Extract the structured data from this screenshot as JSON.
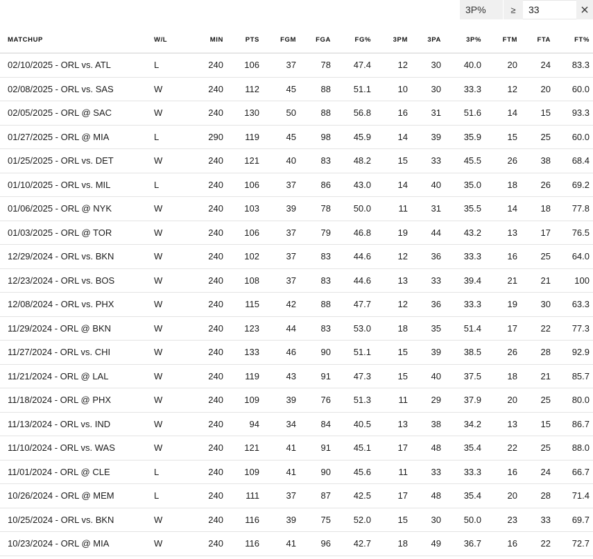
{
  "filter": {
    "stat": "3P%",
    "operator": "≥",
    "value": "33",
    "icons": {
      "clear": "close-icon"
    }
  },
  "columns": [
    "MATCHUP",
    "W/L",
    "MIN",
    "PTS",
    "FGM",
    "FGA",
    "FG%",
    "3PM",
    "3PA",
    "3P%",
    "FTM",
    "FTA",
    "FT%"
  ],
  "colors": {
    "link": "#1d68c5",
    "text": "#1a1a1a",
    "filter_bg": "#f0f0f0"
  },
  "rows": [
    [
      "02/10/2025 - ORL vs. ATL",
      "L",
      "240",
      "106",
      "37",
      "78",
      "47.4",
      "12",
      "30",
      "40.0",
      "20",
      "24",
      "83.3"
    ],
    [
      "02/08/2025 - ORL vs. SAS",
      "W",
      "240",
      "112",
      "45",
      "88",
      "51.1",
      "10",
      "30",
      "33.3",
      "12",
      "20",
      "60.0"
    ],
    [
      "02/05/2025 - ORL @ SAC",
      "W",
      "240",
      "130",
      "50",
      "88",
      "56.8",
      "16",
      "31",
      "51.6",
      "14",
      "15",
      "93.3"
    ],
    [
      "01/27/2025 - ORL @ MIA",
      "L",
      "290",
      "119",
      "45",
      "98",
      "45.9",
      "14",
      "39",
      "35.9",
      "15",
      "25",
      "60.0"
    ],
    [
      "01/25/2025 - ORL vs. DET",
      "W",
      "240",
      "121",
      "40",
      "83",
      "48.2",
      "15",
      "33",
      "45.5",
      "26",
      "38",
      "68.4"
    ],
    [
      "01/10/2025 - ORL vs. MIL",
      "L",
      "240",
      "106",
      "37",
      "86",
      "43.0",
      "14",
      "40",
      "35.0",
      "18",
      "26",
      "69.2"
    ],
    [
      "01/06/2025 - ORL @ NYK",
      "W",
      "240",
      "103",
      "39",
      "78",
      "50.0",
      "11",
      "31",
      "35.5",
      "14",
      "18",
      "77.8"
    ],
    [
      "01/03/2025 - ORL @ TOR",
      "W",
      "240",
      "106",
      "37",
      "79",
      "46.8",
      "19",
      "44",
      "43.2",
      "13",
      "17",
      "76.5"
    ],
    [
      "12/29/2024 - ORL vs. BKN",
      "W",
      "240",
      "102",
      "37",
      "83",
      "44.6",
      "12",
      "36",
      "33.3",
      "16",
      "25",
      "64.0"
    ],
    [
      "12/23/2024 - ORL vs. BOS",
      "W",
      "240",
      "108",
      "37",
      "83",
      "44.6",
      "13",
      "33",
      "39.4",
      "21",
      "21",
      "100"
    ],
    [
      "12/08/2024 - ORL vs. PHX",
      "W",
      "240",
      "115",
      "42",
      "88",
      "47.7",
      "12",
      "36",
      "33.3",
      "19",
      "30",
      "63.3"
    ],
    [
      "11/29/2024 - ORL @ BKN",
      "W",
      "240",
      "123",
      "44",
      "83",
      "53.0",
      "18",
      "35",
      "51.4",
      "17",
      "22",
      "77.3"
    ],
    [
      "11/27/2024 - ORL vs. CHI",
      "W",
      "240",
      "133",
      "46",
      "90",
      "51.1",
      "15",
      "39",
      "38.5",
      "26",
      "28",
      "92.9"
    ],
    [
      "11/21/2024 - ORL @ LAL",
      "W",
      "240",
      "119",
      "43",
      "91",
      "47.3",
      "15",
      "40",
      "37.5",
      "18",
      "21",
      "85.7"
    ],
    [
      "11/18/2024 - ORL @ PHX",
      "W",
      "240",
      "109",
      "39",
      "76",
      "51.3",
      "11",
      "29",
      "37.9",
      "20",
      "25",
      "80.0"
    ],
    [
      "11/13/2024 - ORL vs. IND",
      "W",
      "240",
      "94",
      "34",
      "84",
      "40.5",
      "13",
      "38",
      "34.2",
      "13",
      "15",
      "86.7"
    ],
    [
      "11/10/2024 - ORL vs. WAS",
      "W",
      "240",
      "121",
      "41",
      "91",
      "45.1",
      "17",
      "48",
      "35.4",
      "22",
      "25",
      "88.0"
    ],
    [
      "11/01/2024 - ORL @ CLE",
      "L",
      "240",
      "109",
      "41",
      "90",
      "45.6",
      "11",
      "33",
      "33.3",
      "16",
      "24",
      "66.7"
    ],
    [
      "10/26/2024 - ORL @ MEM",
      "L",
      "240",
      "111",
      "37",
      "87",
      "42.5",
      "17",
      "48",
      "35.4",
      "20",
      "28",
      "71.4"
    ],
    [
      "10/25/2024 - ORL vs. BKN",
      "W",
      "240",
      "116",
      "39",
      "75",
      "52.0",
      "15",
      "30",
      "50.0",
      "23",
      "33",
      "69.7"
    ],
    [
      "10/23/2024 - ORL @ MIA",
      "W",
      "240",
      "116",
      "41",
      "96",
      "42.7",
      "18",
      "49",
      "36.7",
      "16",
      "22",
      "72.7"
    ]
  ]
}
